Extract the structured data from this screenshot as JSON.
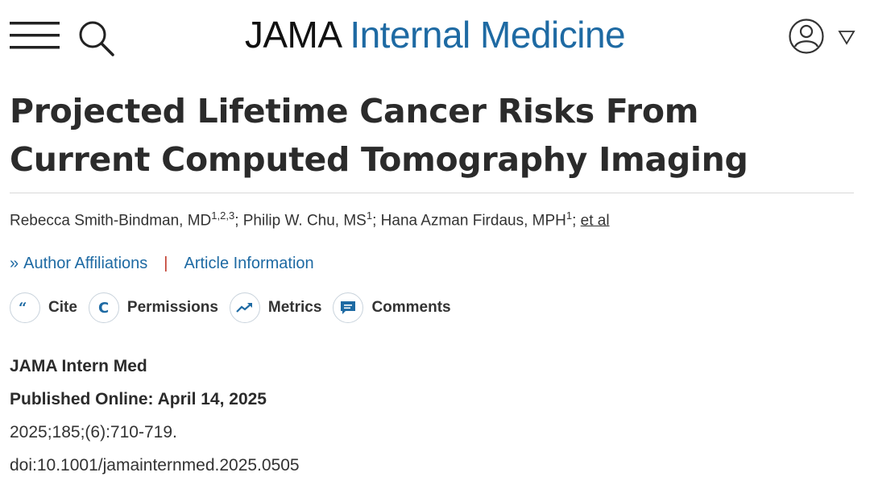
{
  "header": {
    "brand_primary": "JAMA",
    "brand_secondary": "Internal Medicine",
    "brand_color": "#1e6aa3"
  },
  "icons": {
    "menu": "hamburger-menu-icon",
    "search": "search-icon",
    "user": "user-account-icon",
    "caret": "chevron-down-icon"
  },
  "article": {
    "title": "Projected Lifetime Cancer Risks From Current Computed Tomography Imaging",
    "authors": [
      {
        "name": "Rebecca Smith-Bindman, MD",
        "sup": "1,2,3"
      },
      {
        "name": "Philip W. Chu, MS",
        "sup": "1"
      },
      {
        "name": "Hana Azman Firdaus, MPH",
        "sup": "1"
      }
    ],
    "etal": "et al",
    "author_affiliations": "Author Affiliations",
    "separator": "|",
    "article_information": "Article Information"
  },
  "actions": {
    "cite": "Cite",
    "permissions": "Permissions",
    "metrics": "Metrics",
    "comments": "Comments"
  },
  "meta": {
    "journal": "JAMA Intern Med",
    "published_label": "Published Online:",
    "published_date": "April 14, 2025",
    "citation": "2025;185;(6):710-719.",
    "doi": "doi:10.1001/jamainternmed.2025.0505"
  }
}
